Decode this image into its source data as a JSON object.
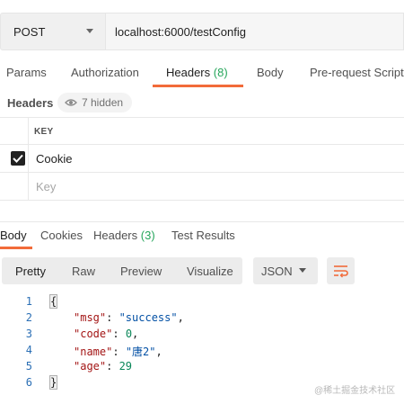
{
  "request": {
    "method": "POST",
    "url": "localhost:6000/testConfig"
  },
  "request_tabs": {
    "params": "Params",
    "authorization": "Authorization",
    "headers": "Headers",
    "headers_count": "(8)",
    "body": "Body",
    "prerequest": "Pre-request Script"
  },
  "headers_section": {
    "title": "Headers",
    "hidden": "7 hidden"
  },
  "headers_table": {
    "column_key": "KEY",
    "rows": [
      {
        "key": "Cookie",
        "checked": true
      }
    ],
    "placeholder": "Key"
  },
  "response_tabs": {
    "body": "Body",
    "cookies": "Cookies",
    "headers": "Headers",
    "headers_count": "(3)",
    "test_results": "Test Results"
  },
  "response_toolbar": {
    "pretty": "Pretty",
    "raw": "Raw",
    "preview": "Preview",
    "visualize": "Visualize",
    "format": "JSON",
    "wrap_icon": "wrap-lines-icon"
  },
  "code": {
    "line_numbers": [
      "1",
      "2",
      "3",
      "4",
      "5",
      "6"
    ],
    "open_brace": "{",
    "close_brace": "}",
    "msg_key": "\"msg\"",
    "msg_val": "\"success\"",
    "code_key": "\"code\"",
    "code_val": "0",
    "name_key": "\"name\"",
    "name_val": "\"唐2\"",
    "age_key": "\"age\"",
    "age_val": "29"
  },
  "watermark": "@稀土掘金技术社区",
  "colors": {
    "accent": "#f26b3a",
    "count_green": "#26a65b"
  }
}
